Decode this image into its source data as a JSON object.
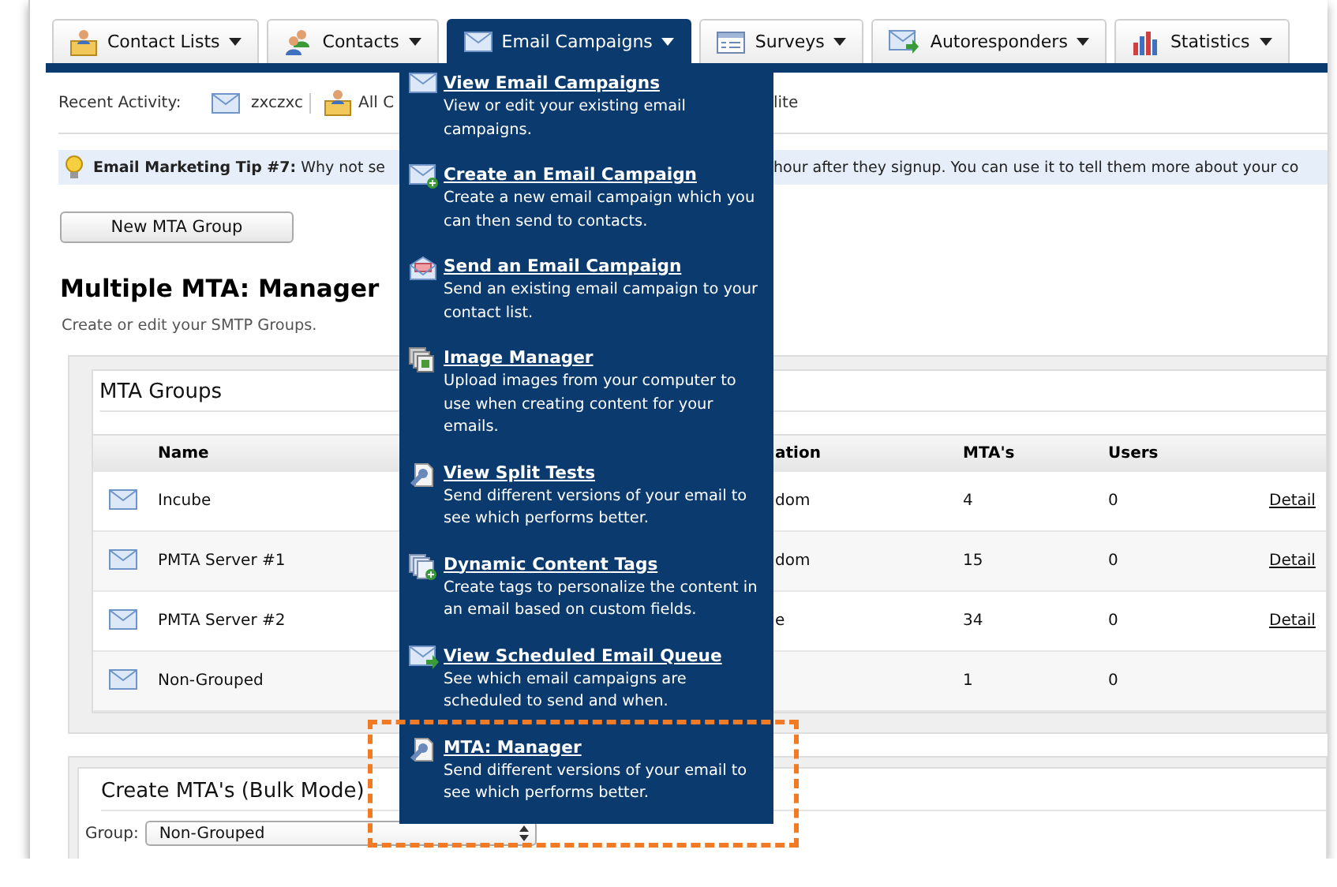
{
  "tabs": [
    {
      "label": "Contact Lists",
      "selected": false
    },
    {
      "label": "Contacts",
      "selected": false
    },
    {
      "label": "Email Campaigns",
      "selected": true
    },
    {
      "label": "Surveys",
      "selected": false
    },
    {
      "label": "Autoresponders",
      "selected": false
    },
    {
      "label": "Statistics",
      "selected": false
    }
  ],
  "recent_activity": {
    "label": "Recent Activity:",
    "items": [
      {
        "label": "zxczxc"
      },
      {
        "label": "All C"
      },
      {
        "label": "lite"
      }
    ]
  },
  "tip": {
    "text": "**Email Marketing Tip #7:** Why not se",
    "text_continued": "hour after they signup. You can use it to tell them more about your co"
  },
  "new_group_button": "New MTA Group",
  "title": "Multiple MTA: Manager",
  "subtitle": "Create or edit your SMTP Groups.",
  "mta_groups": {
    "title": "MTA Groups",
    "columns": [
      "Name",
      "ation",
      "MTA's",
      "Users"
    ],
    "rows": [
      {
        "name": "Incube",
        "column_3": "dom",
        "mtas": "4",
        "users": "0",
        "link": "Detail"
      },
      {
        "name": "PMTA Server #1",
        "column_3": "dom",
        "mtas": "15",
        "users": "0",
        "link": "Detail"
      },
      {
        "name": "PMTA Server #2",
        "column_3": "e",
        "mtas": "34",
        "users": "0",
        "link": "Detail"
      },
      {
        "name": "Non-Grouped",
        "mtas": "1",
        "users": "0"
      }
    ]
  },
  "bulk": {
    "title": "Create MTA's (Bulk Mode)",
    "group_label": "Group:",
    "group_value": "Non-Grouped"
  },
  "menu": {
    "items": [
      {
        "title": "View Email Campaigns",
        "description": "View or edit your existing email campaigns.",
        "highlighted": false
      },
      {
        "title": "Create an Email Campaign",
        "description": "Create a new email campaign which you can then send to contacts.",
        "highlighted": false
      },
      {
        "title": "Send an Email Campaign",
        "description": "Send an existing email campaign to your contact list.",
        "highlighted": false
      },
      {
        "title": "Image Manager",
        "description": "Upload images from your computer to use when creating content for your emails.",
        "highlighted": false
      },
      {
        "title": "View Split Tests",
        "description": "Send different versions of your email to see which performs better.",
        "highlighted": false
      },
      {
        "title": "Dynamic Content Tags",
        "description": "Create tags to personalize the content in an email based on custom fields.",
        "highlighted": false
      },
      {
        "title": "View Scheduled Email Queue",
        "description": "See which email campaigns are scheduled to send and when.",
        "highlighted": false
      },
      {
        "title": "MTA: Manager",
        "description": "Send different versions of your email to see which performs better.",
        "highlighted": true
      }
    ]
  }
}
